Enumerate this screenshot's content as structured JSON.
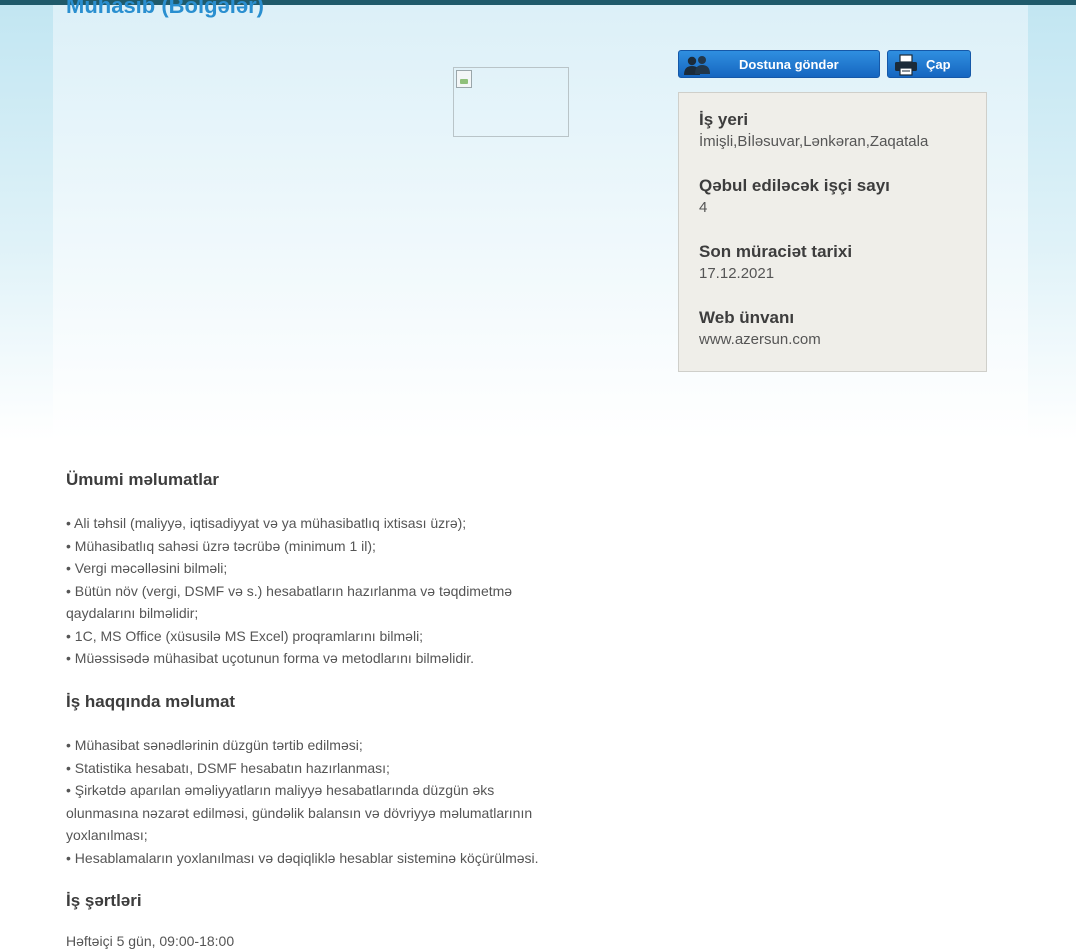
{
  "job_title": "Mühasib (Bölgələr)",
  "actions": {
    "share_label": "Dostuna göndər",
    "print_label": "Çap"
  },
  "info": {
    "workplace_label": "İş yeri",
    "workplace_value": "İmişli,Bİləsuvar,Lənkəran,Zaqatala",
    "headcount_label": "Qəbul ediləcək işçi sayı",
    "headcount_value": "4",
    "deadline_label": "Son müraciət tarixi",
    "deadline_value": "17.12.2021",
    "web_label": "Web ünvanı",
    "web_value": "www.azersun.com"
  },
  "sections": {
    "general": {
      "title": "Ümumi məlumatlar",
      "lines": [
        "• Ali təhsil (maliyyə, iqtisadiyyat və ya mühasibatlıq ixtisası üzrə);",
        "• Mühasibatlıq sahəsi üzrə təcrübə (minimum 1 il);",
        "• Vergi məcəlləsini bilməli;",
        "• Bütün növ (vergi, DSMF və s.) hesabatların hazırlanma və təqdimetmə",
        "qaydalarını bilməlidir;",
        "• 1C, MS Office (xüsusilə MS Excel) proqramlarını bilməli;",
        "• Müəssisədə mühasibat uçotunun forma və metodlarını bilməlidir."
      ]
    },
    "job": {
      "title": "İş haqqında məlumat",
      "lines": [
        "• Mühasibat sənədlərinin düzgün tərtib edilməsi;",
        "• Statistika hesabatı, DSMF hesabatın hazırlanması;",
        "• Şirkətdə aparılan əməliyyatların maliyyə hesabatlarında düzgün əks",
        "olunmasına nəzarət edilməsi, gündəlik balansın və dövriyyə məlumatlarının",
        "yoxlanılması;",
        "• Hesablamaların yoxlanılması və dəqiqliklə hesablar sisteminə köçürülməsi."
      ]
    },
    "conditions": {
      "title": "İş şərtləri",
      "lines": [
        "Həftəiçi 5 gün, 09:00-18:00"
      ]
    }
  }
}
